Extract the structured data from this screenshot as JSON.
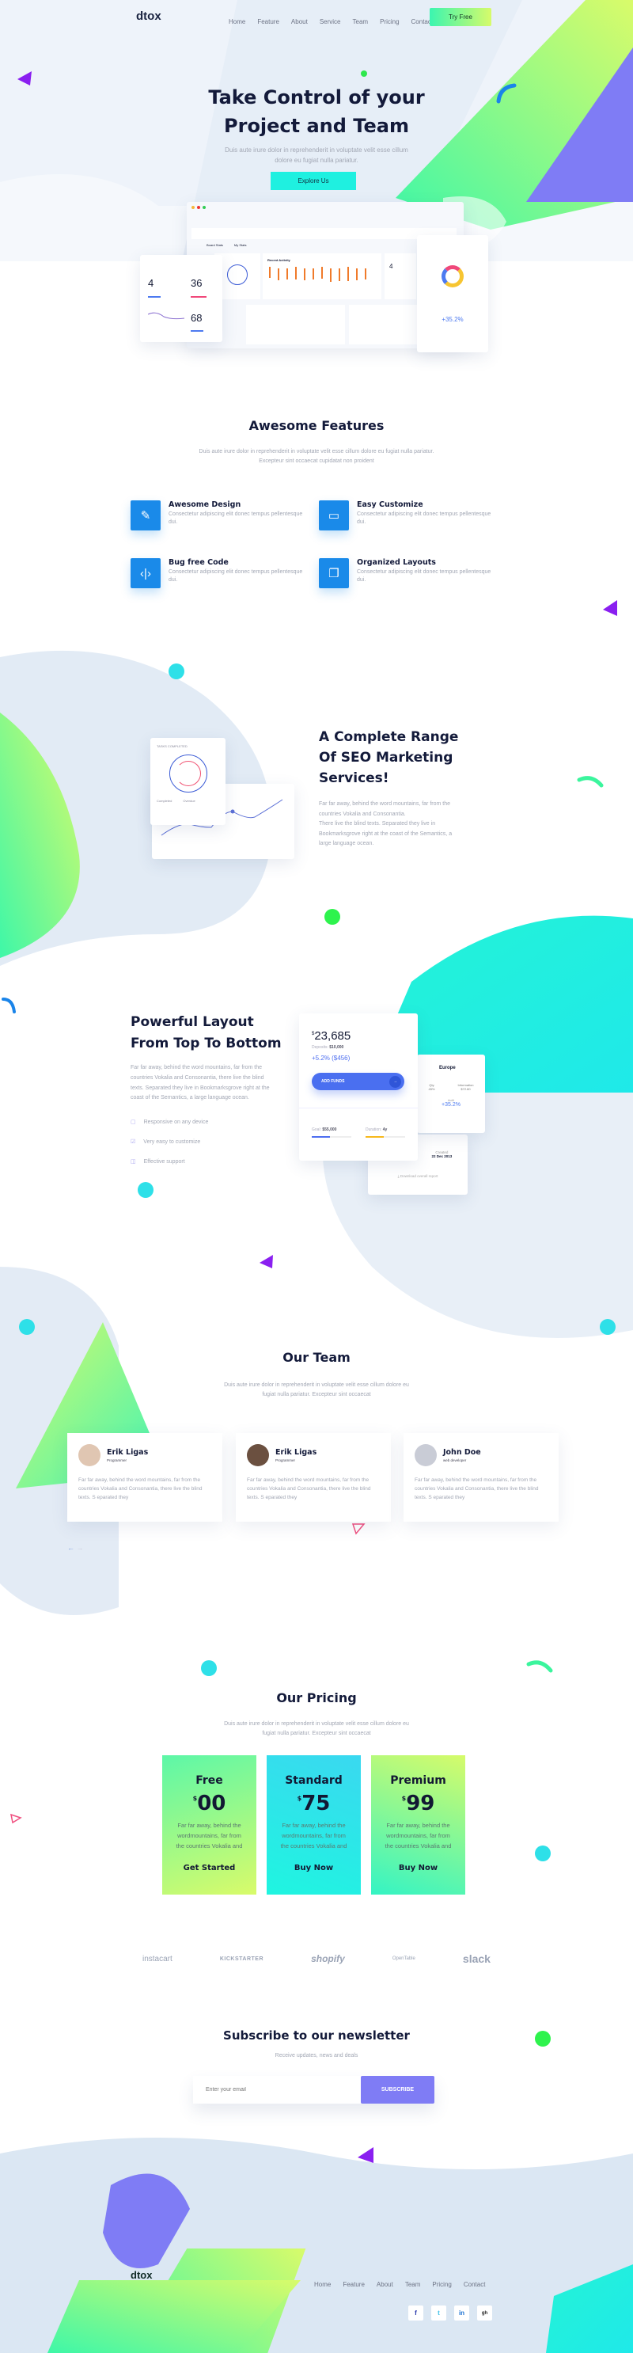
{
  "brand": "dtox",
  "colors": {
    "accent_blue": "#1a8ae9",
    "cyan": "#1ff0e0",
    "green": "#4dfb8e",
    "lime": "#d7fb6a",
    "purple": "#7f7cf5",
    "dark": "#131a3a"
  },
  "nav": {
    "links": [
      "Home",
      "Feature",
      "About",
      "Service",
      "Team",
      "Pricing",
      "Contact"
    ],
    "cta": "Try Free"
  },
  "hero": {
    "title_line1": "Take Control of your",
    "title_line2": "Project and Team",
    "subtitle_line1": "Duis aute irure dolor in reprehenderit in voluptate velit esse cillum",
    "subtitle_line2": "dolore eu fugiat nulla pariatur.",
    "button": "Explore Us",
    "dashboard": {
      "tabs": [
        "Board Stats",
        "My Stats"
      ],
      "recent_activity": "Recent Activity",
      "stats": [
        {
          "value": "4"
        },
        {
          "value": "36"
        },
        {
          "value": "68"
        }
      ],
      "right_stat": "+35.2%",
      "side_value": "4"
    }
  },
  "features": {
    "title": "Awesome Features",
    "subtitle_line1": "Duis aute irure dolor in reprehenderit in voluptate velit esse cillum dolore eu fugiat nulla pariatur.",
    "subtitle_line2": "Excepteur sint occaecat cupidatat non proident",
    "items": [
      {
        "title": "Awesome Design",
        "desc": "Consectetur adipiscing elit donec tempus pellentesque dui.",
        "icon": "pencil-ruler-icon"
      },
      {
        "title": "Easy Customize",
        "desc": "Consectetur adipiscing elit donec tempus pellentesque dui.",
        "icon": "window-icon"
      },
      {
        "title": "Bug free Code",
        "desc": "Consectetur adipiscing elit donec tempus pellentesque dui.",
        "icon": "code-icon"
      },
      {
        "title": "Organized Layouts",
        "desc": "Consectetur adipiscing elit donec tempus pellentesque dui.",
        "icon": "layers-icon"
      }
    ]
  },
  "seo": {
    "title_line1": "A Complete Range",
    "title_line2": "Of SEO Marketing",
    "title_line3": "Services!",
    "text_line1": "Far far away, behind the word mountains, far from the countries Vokalia and Consonantia.",
    "text_line2": "There live the blind texts. Separated they live in Bookmarksgrove right at the coast of the Semantics, a large language ocean.",
    "card_title": "TASKS COMPLETED",
    "legend": [
      "Completed",
      "Overdue"
    ]
  },
  "layout": {
    "title_line1": "Powerful Layout",
    "title_line2": "From Top To Bottom",
    "text": "Far far away, behind the word mountains, far from the countries Vokalia and Consonantia, there live the blind texts. Separated they live in Bookmarksgrove right at the coast of the Semantics, a large language ocean.",
    "list": [
      "Responsive on any device",
      "Very easy to customize",
      "Effective support"
    ],
    "card": {
      "currency": "$",
      "amount": "23,685",
      "deposits_label": "Deposits:",
      "deposits": "$10,000",
      "change": "+5.2% ($456)",
      "button": "ADD FUNDS",
      "goal_label": "Goal:",
      "goal": "$55,000",
      "goal_progress": 0.45,
      "duration_label": "Duration:",
      "duration": "4y",
      "duration_progress": 0.45
    },
    "card2": {
      "region": "Europe",
      "items": [
        {
          "label": "Qty",
          "value": "45%"
        },
        {
          "label": "Information",
          "value": "$72.80"
        }
      ],
      "audit_label": "Audit",
      "audit": "+35.2%"
    },
    "card3": {
      "id": "AWS 2455",
      "created_label": "Created",
      "created": "22 Dec 2013",
      "download": "Download overall report"
    }
  },
  "team": {
    "title": "Our Team",
    "subtitle_line1": "Duis aute irure dolor in reprehenderit in voluptate velit esse cillum dolore eu",
    "subtitle_line2": "fugiat nulla pariatur. Excepteur sint occaecat",
    "members": [
      {
        "name": "Erik Ligas",
        "role": "Programmer",
        "bio": "Far far away, behind the word mountains, far from the countries Vokalia and Consonantia, there live the blind texts. S eparated they"
      },
      {
        "name": "Erik Ligas",
        "role": "Programmer",
        "bio": "Far far away, behind the word mountains, far from the countries Vokalia and Consonantia, there live the blind texts. S eparated they"
      },
      {
        "name": "John Doe",
        "role": "web developer",
        "bio": "Far far away, behind the word mountains, far from the countries Vokalia and Consonantia, there live the blind texts. S eparated they"
      }
    ]
  },
  "pricing": {
    "title": "Our Pricing",
    "subtitle_line1": "Duis aute irure dolor in reprehenderit in voluptate velit esse cillum dolore eu",
    "subtitle_line2": "fugiat nulla pariatur. Excepteur sint occaecat",
    "plans": [
      {
        "name": "Free",
        "currency": "$",
        "price": "00",
        "desc": "Far far away, behind the wordmountains, far from the countries Vokalia and",
        "button": "Get Started"
      },
      {
        "name": "Standard",
        "currency": "$",
        "price": "75",
        "desc": "Far far away, behind the wordmountains, far from the countries Vokalia and",
        "button": "Buy Now"
      },
      {
        "name": "Premium",
        "currency": "$",
        "price": "99",
        "desc": "Far far away, behind the wordmountains, far from the countries Vokalia and",
        "button": "Buy Now"
      }
    ]
  },
  "logos": [
    "instacart",
    "KICKSTARTER",
    "shopify",
    "OpenTable",
    "slack"
  ],
  "newsletter": {
    "title": "Subscribe to our newsletter",
    "subtitle": "Receive updates, news and deals",
    "placeholder": "Enter your email",
    "button": "SUBSCRIBE"
  },
  "footer": {
    "links": [
      "Home",
      "Feature",
      "About",
      "Team",
      "Pricing",
      "Contact"
    ],
    "social": [
      "f",
      "t",
      "in",
      "gh"
    ]
  }
}
